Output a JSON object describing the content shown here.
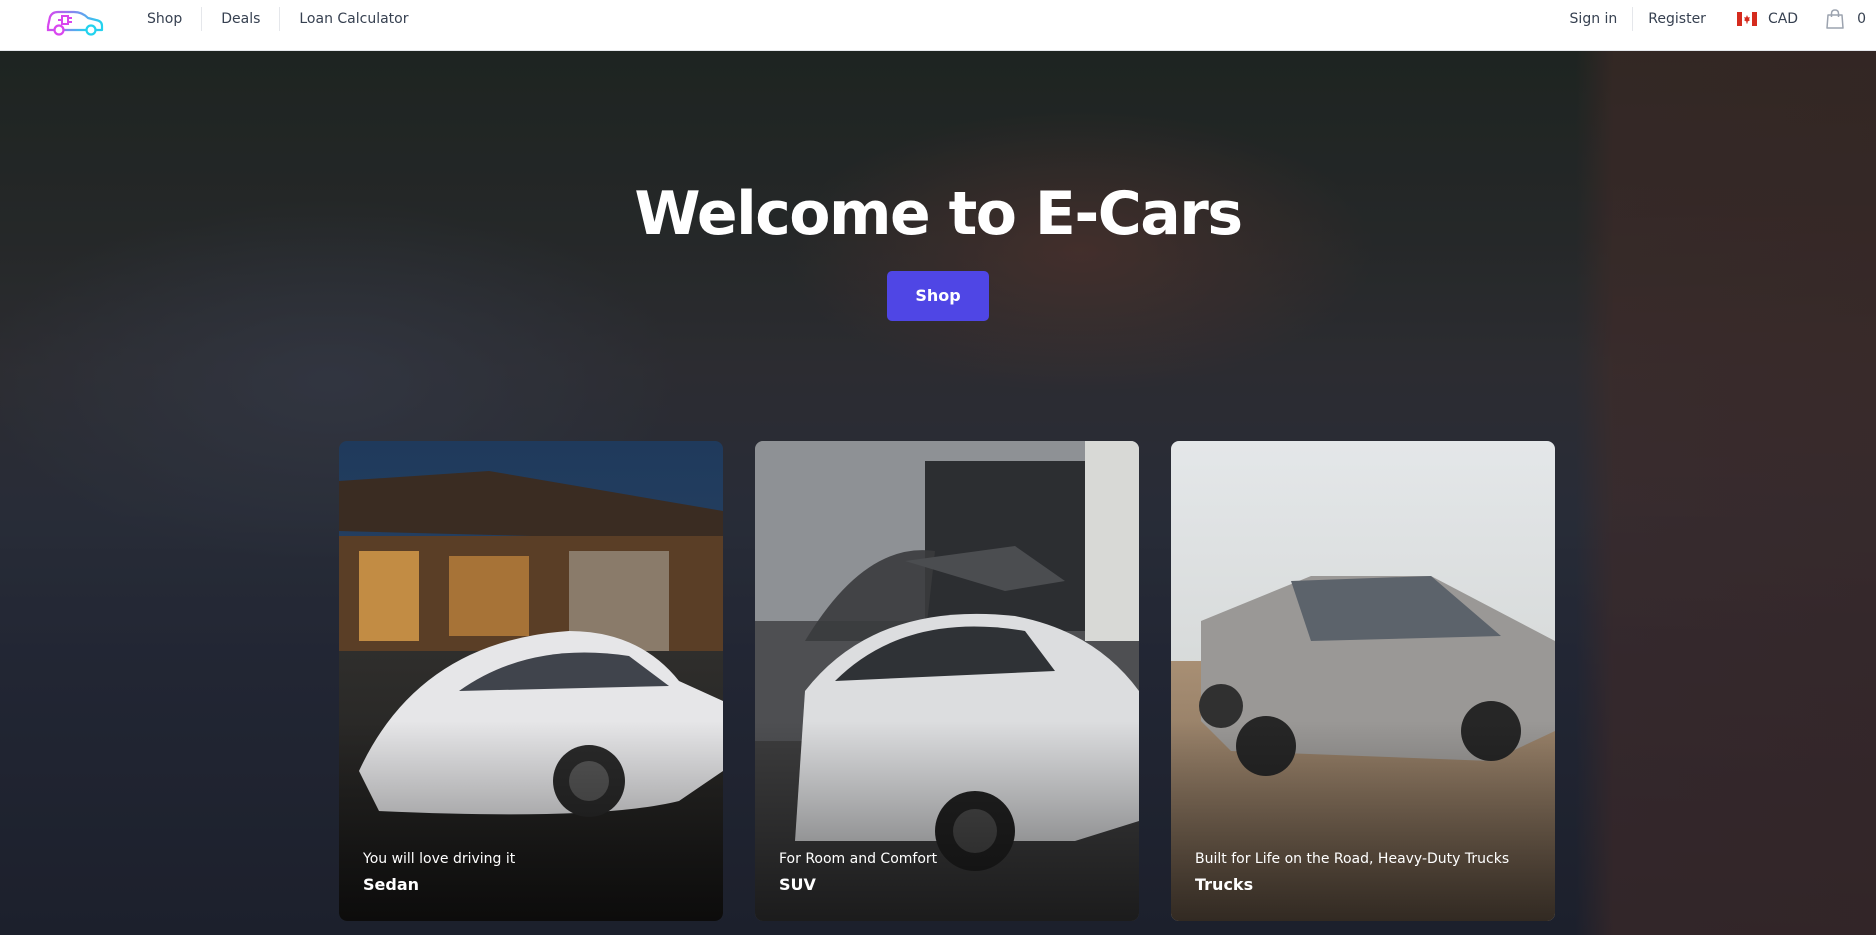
{
  "nav": {
    "links": [
      "Shop",
      "Deals",
      "Loan Calculator"
    ],
    "sign_in": "Sign in",
    "register": "Register",
    "currency": "CAD",
    "cart_count": "0"
  },
  "hero": {
    "title": "Welcome to E-Cars",
    "button": "Shop"
  },
  "categories": [
    {
      "subtitle": "You will love driving it",
      "title": "Sedan"
    },
    {
      "subtitle": "For Room and Comfort",
      "title": "SUV"
    },
    {
      "subtitle": "Built for Life on the Road, Heavy-Duty Trucks",
      "title": "Trucks"
    }
  ],
  "colors": {
    "primary_button": "#4f46e5",
    "logo_magenta": "#d946ef",
    "logo_cyan": "#22d3ee"
  },
  "icons": [
    "ecar-logo",
    "canada-flag-icon",
    "shopping-bag-icon"
  ]
}
